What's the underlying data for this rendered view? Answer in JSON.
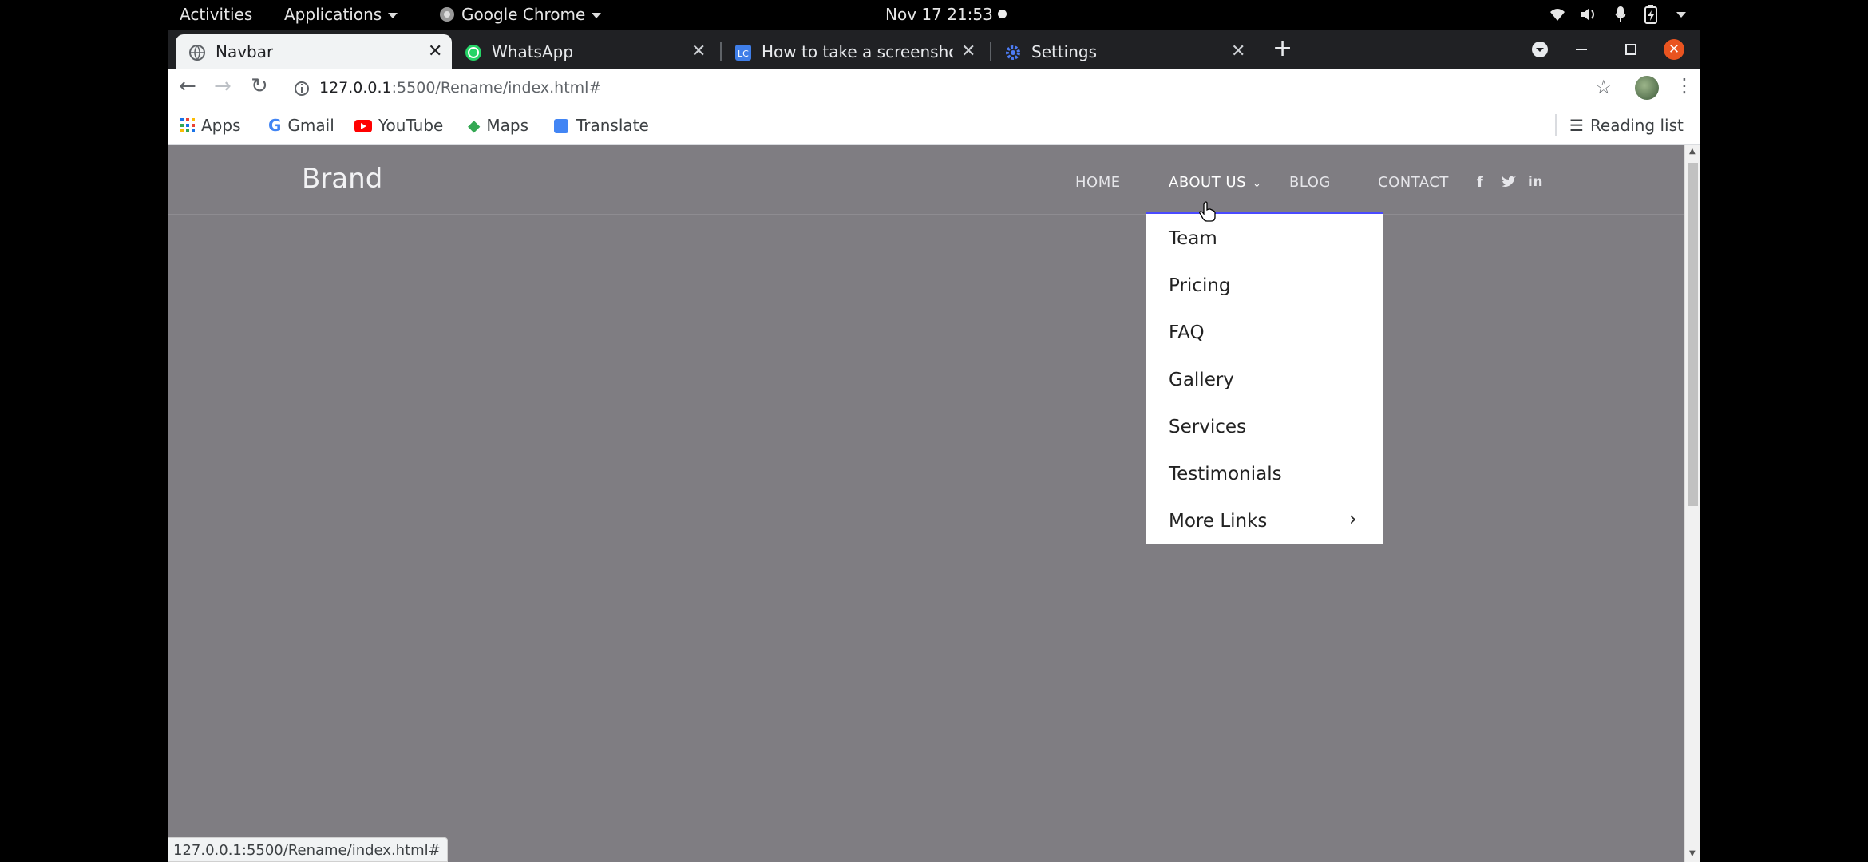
{
  "system_bar": {
    "activities": "Activities",
    "applications": "Applications",
    "app_name": "Google Chrome",
    "datetime": "Nov 17  21:53"
  },
  "tabs": [
    {
      "title": "Navbar",
      "icon": "globe-icon",
      "active": true
    },
    {
      "title": "WhatsApp",
      "icon": "whatsapp-icon",
      "active": false
    },
    {
      "title": "How to take a screenshot",
      "icon": "lc-icon",
      "active": false
    },
    {
      "title": "Settings",
      "icon": "gear-icon",
      "active": false
    }
  ],
  "address": {
    "host": "127.0.0.1",
    "path": ":5500/Rename/index.html#"
  },
  "bookmarks": {
    "apps": "Apps",
    "items": [
      "Gmail",
      "YouTube",
      "Maps",
      "Translate"
    ],
    "reading_list": "Reading list"
  },
  "site": {
    "brand": "Brand",
    "nav": [
      "HOME",
      "ABOUT US",
      "BLOG",
      "CONTACT"
    ],
    "social_icons": [
      "facebook-icon",
      "twitter-icon",
      "linkedin-icon"
    ],
    "dropdown": [
      "Team",
      "Pricing",
      "FAQ",
      "Gallery",
      "Services",
      "Testimonials",
      "More Links"
    ]
  },
  "status_url": "127.0.0.1:5500/Rename/index.html#",
  "colors": {
    "page_bg": "#7f7d82",
    "dropdown_accent": "#4a4aff",
    "close_button": "#e95420"
  }
}
